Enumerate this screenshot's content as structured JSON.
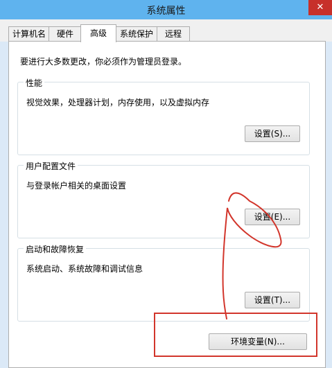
{
  "window": {
    "title": "系统属性",
    "close_icon": "close-icon"
  },
  "tabs": [
    {
      "label": "计算机名",
      "active": false
    },
    {
      "label": "硬件",
      "active": false
    },
    {
      "label": "高级",
      "active": true
    },
    {
      "label": "系统保护",
      "active": false
    },
    {
      "label": "远程",
      "active": false
    }
  ],
  "notice": "要进行大多数更改，你必须作为管理员登录。",
  "groups": {
    "performance": {
      "title": "性能",
      "description": "视觉效果，处理器计划，内存使用，以及虚拟内存",
      "button": "设置(S)..."
    },
    "user_profiles": {
      "title": "用户配置文件",
      "description": "与登录帐户相关的桌面设置",
      "button": "设置(E)..."
    },
    "startup_recovery": {
      "title": "启动和故障恢复",
      "description": "系统启动、系统故障和调试信息",
      "button": "设置(T)..."
    }
  },
  "env_button": "环境变量(N)...",
  "annotation_color": "#d2352b"
}
